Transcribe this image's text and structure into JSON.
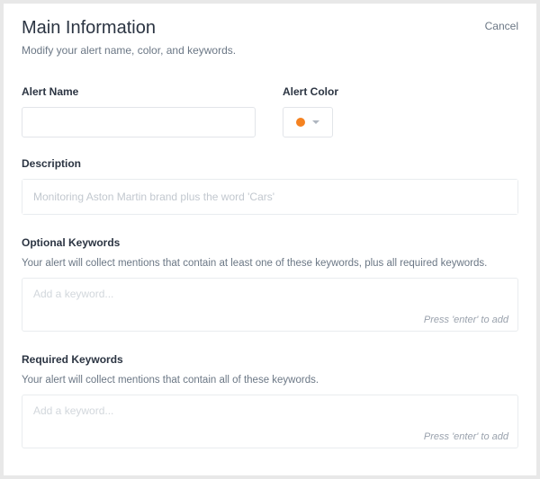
{
  "header": {
    "title": "Main Information",
    "subtitle": "Modify your alert name, color, and keywords.",
    "cancel": "Cancel"
  },
  "alertName": {
    "label": "Alert Name",
    "value": ""
  },
  "alertColor": {
    "label": "Alert Color",
    "value": "#f58220"
  },
  "description": {
    "label": "Description",
    "placeholder": "Monitoring Aston Martin brand plus the word 'Cars'",
    "value": ""
  },
  "optionalKeywords": {
    "label": "Optional Keywords",
    "helper": "Your alert will collect mentions that contain at least one of these keywords, plus all required keywords.",
    "placeholder": "Add a keyword...",
    "hint": "Press 'enter' to add"
  },
  "requiredKeywords": {
    "label": "Required Keywords",
    "helper": "Your alert will collect mentions that contain all of these keywords.",
    "placeholder": "Add a keyword...",
    "hint": "Press 'enter' to add"
  }
}
